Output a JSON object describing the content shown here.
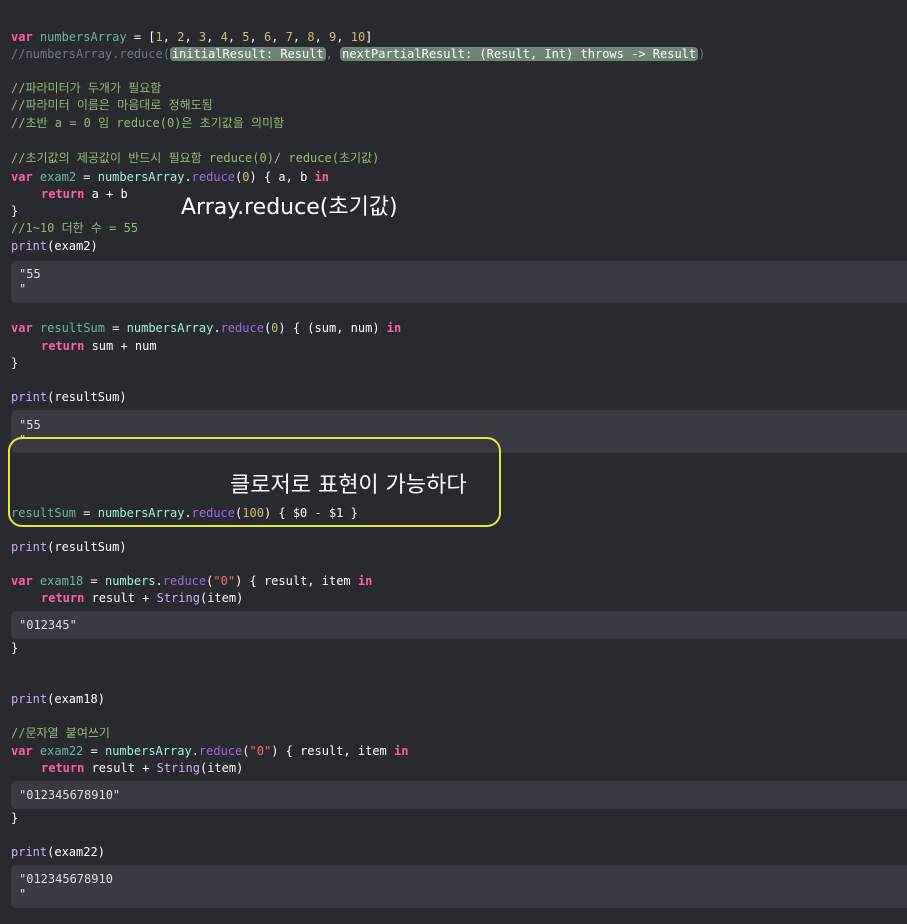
{
  "code": {
    "l1": {
      "kw": "var",
      "name": "numbersArray",
      "rest": " = [",
      "n": [
        "1",
        "2",
        "3",
        "4",
        "5",
        "6",
        "7",
        "8",
        "9",
        "10"
      ],
      "close": "]"
    },
    "l2": {
      "prefix": "//numbersArray.reduce(",
      "ph1": "initialResult: Result",
      "sep": ", ",
      "ph2": "nextPartialResult: (Result, Int) throws -> Result",
      "suffix": ")"
    },
    "c1": "//파라미터가 두개가 필요함",
    "c2": "//파라미터 이름은 마음대로 정해도됨",
    "c3": "//초반 a = 0 임 reduce(0)은 초기값을 의미함",
    "c4": "//초기값의 제공값이 반드시 필요함 reduce(0)/ reduce(초기값)",
    "exam2": {
      "kw": "var",
      "name": "exam2",
      "eq": " = ",
      "recv": "numbersArray",
      "dot": ".",
      "method": "reduce",
      "open": "(",
      "arg": "0",
      "close": ") { a, b ",
      "in": "in"
    },
    "ret1": {
      "kw": "return",
      "expr": " a + b"
    },
    "brace1": "}",
    "c5": "//1~10 더한 수 = 55",
    "print_exam2": {
      "fn": "print",
      "arg": "(exam2)"
    },
    "res1": "\"55\n\"",
    "resultSum": {
      "kw": "var",
      "name": "resultSum",
      "eq": " = ",
      "recv": "numbersArray",
      "dot": ".",
      "method": "reduce",
      "open": "(",
      "arg": "0",
      "close": ") { (sum, num) ",
      "in": "in"
    },
    "ret2": {
      "kw": "return",
      "expr": " sum + num"
    },
    "brace2": "}",
    "print_resultSum": {
      "fn": "print",
      "arg": "(resultSum)"
    },
    "res2": "\"55\n\"",
    "closure": {
      "name": "resultSum",
      "eq": " = ",
      "recv": "numbersArray",
      "dot": ".",
      "method": "reduce",
      "open": "(",
      "arg": "100",
      "close": ") { $0 - $1 }"
    },
    "print_resultSum2": {
      "fn": "print",
      "arg": "(resultSum)"
    },
    "exam18": {
      "kw": "var",
      "name": "exam18",
      "eq": " = ",
      "recv": "numbers",
      "dot": ".",
      "method": "reduce",
      "open": "(",
      "arg": "\"0\"",
      "close": ") { result, item ",
      "in": "in"
    },
    "ret3": {
      "kw": "return",
      "expr1": " result + ",
      "type": "String",
      "expr2": "(item)"
    },
    "res3": "\"012345\"",
    "brace3": "}",
    "print_exam18": {
      "fn": "print",
      "arg": "(exam18)"
    },
    "c6": "//문자열 붙여쓰기",
    "exam22": {
      "kw": "var",
      "name": "exam22",
      "eq": " = ",
      "recv": "numbersArray",
      "dot": ".",
      "method": "reduce",
      "open": "(",
      "arg": "\"0\"",
      "close": ") { result, item ",
      "in": "in"
    },
    "ret4": {
      "kw": "return",
      "expr1": " result + ",
      "type": "String",
      "expr2": "(item)"
    },
    "res4": "\"012345678910\"",
    "brace4": "}",
    "print_exam22": {
      "fn": "print",
      "arg": "(exam22)"
    },
    "res5": "\"012345678910\n\""
  },
  "annotations": {
    "label1": "Array.reduce(초기값)",
    "label2": "클로저로 표현이 가능하다"
  },
  "colors": {
    "background": "#292a30",
    "keyword": "#fc5fa3",
    "number": "#d0bf69",
    "string": "#fc6a5d",
    "callout": "#e6e640"
  }
}
